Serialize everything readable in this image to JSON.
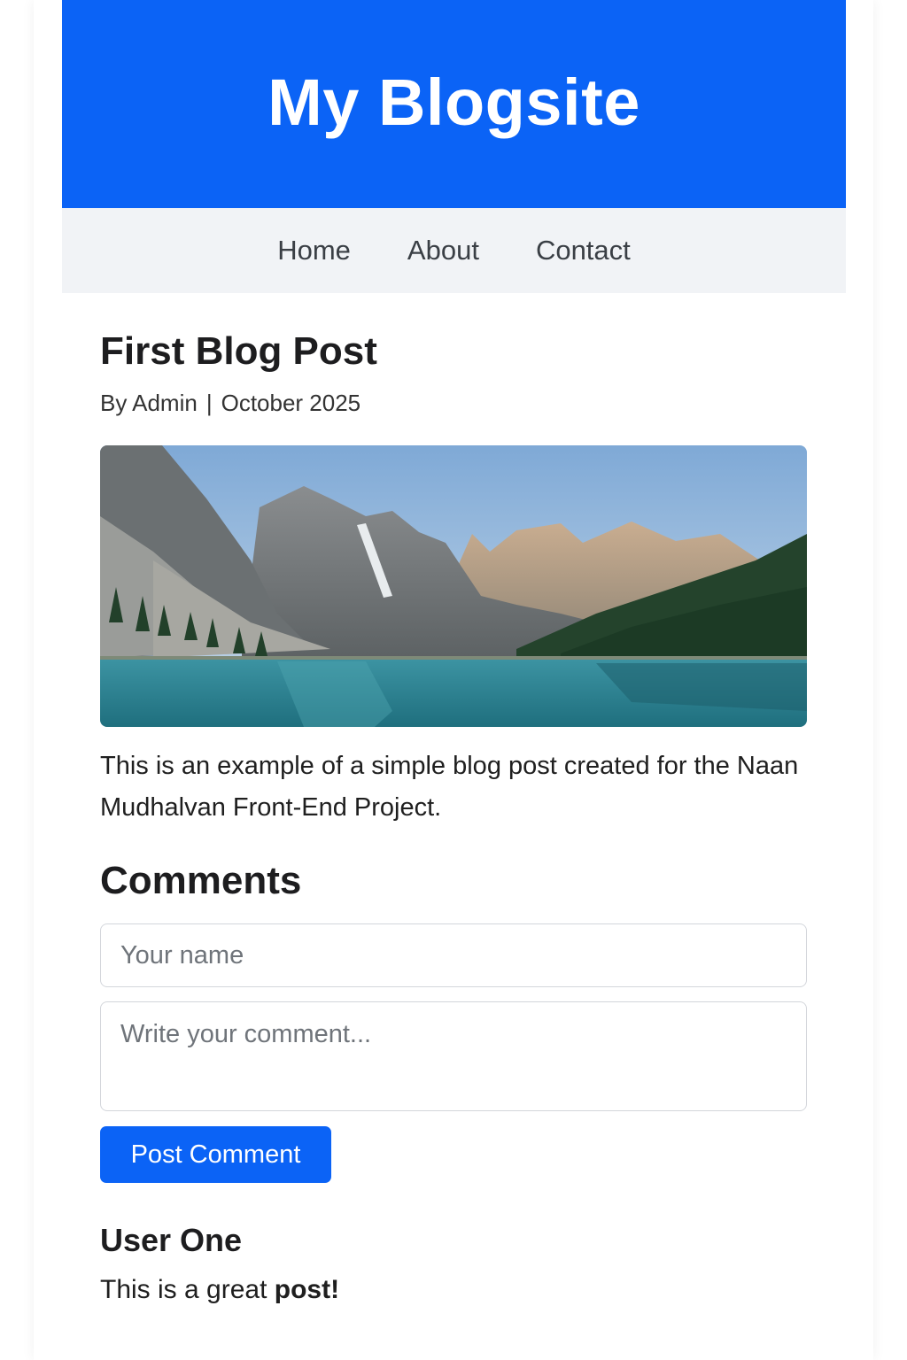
{
  "header": {
    "site_title": "My Blogsite",
    "background_color": "#0b63f6"
  },
  "nav": {
    "items": [
      {
        "label": "Home"
      },
      {
        "label": "About"
      },
      {
        "label": "Contact"
      }
    ]
  },
  "post": {
    "title": "First Blog Post",
    "author": "By Admin",
    "separator": "|",
    "date": "October 2025",
    "image_subject": "mountain-lake-landscape",
    "body": "This is an example of a simple blog post created for the Naan Mudhalvan Front-End Project."
  },
  "comments": {
    "heading": "Comments",
    "name_placeholder": "Your name",
    "comment_placeholder": "Write your comment...",
    "submit_label": "Post Comment",
    "list": [
      {
        "author": "User One",
        "text_plain": "This is a great ",
        "text_bold": "post!"
      }
    ]
  }
}
